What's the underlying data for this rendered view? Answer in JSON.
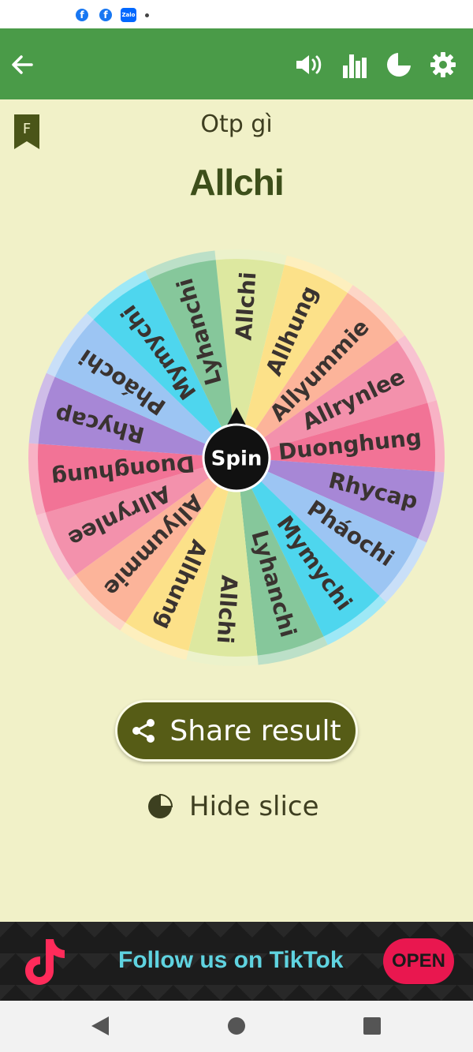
{
  "status_bar": {
    "notification_icons": [
      "facebook-icon",
      "facebook-icon",
      "zalo-icon",
      "more-dot-icon"
    ],
    "zalo_label": "Zalo"
  },
  "app_bar": {
    "background": "#4a9b48",
    "icons": [
      "back-arrow-icon",
      "volume-icon",
      "stats-icon",
      "pie-chart-icon",
      "settings-icon"
    ]
  },
  "header": {
    "bookmark_letter": "F",
    "wheel_title": "Otp gì",
    "result": "Allchi"
  },
  "wheel": {
    "center_label": "Spin",
    "slices": [
      {
        "label": "Allchi",
        "color": "#dde8a0"
      },
      {
        "label": "Allhung",
        "color": "#fce189"
      },
      {
        "label": "Allyummie",
        "color": "#fcb49a"
      },
      {
        "label": "Allrynlee",
        "color": "#f391ac"
      },
      {
        "label": "Duonghung",
        "color": "#f27396"
      },
      {
        "label": "Rhycap",
        "color": "#a787d6"
      },
      {
        "label": "Pháochi",
        "color": "#9cc5f3"
      },
      {
        "label": "Mymychi",
        "color": "#4ed6ee"
      },
      {
        "label": "Lyhanchi",
        "color": "#86c79b"
      },
      {
        "label": "Allchi",
        "color": "#dde8a0"
      },
      {
        "label": "Allhung",
        "color": "#fce189"
      },
      {
        "label": "Allyummie",
        "color": "#fcb49a"
      },
      {
        "label": "Allrynlee",
        "color": "#f391ac"
      },
      {
        "label": "Duonghung",
        "color": "#f27396"
      },
      {
        "label": "Rhycap",
        "color": "#a787d6"
      },
      {
        "label": "Pháochi",
        "color": "#9cc5f3"
      },
      {
        "label": "Mymychi",
        "color": "#4ed6ee"
      },
      {
        "label": "Lyhanchi",
        "color": "#86c79b"
      }
    ]
  },
  "actions": {
    "share_label": "Share result",
    "hide_slice_label": "Hide slice"
  },
  "ad": {
    "text": "Follow us on TikTok",
    "button": "OPEN"
  },
  "nav_bar": {
    "icons": [
      "back-triangle-icon",
      "home-circle-icon",
      "recents-square-icon"
    ]
  }
}
